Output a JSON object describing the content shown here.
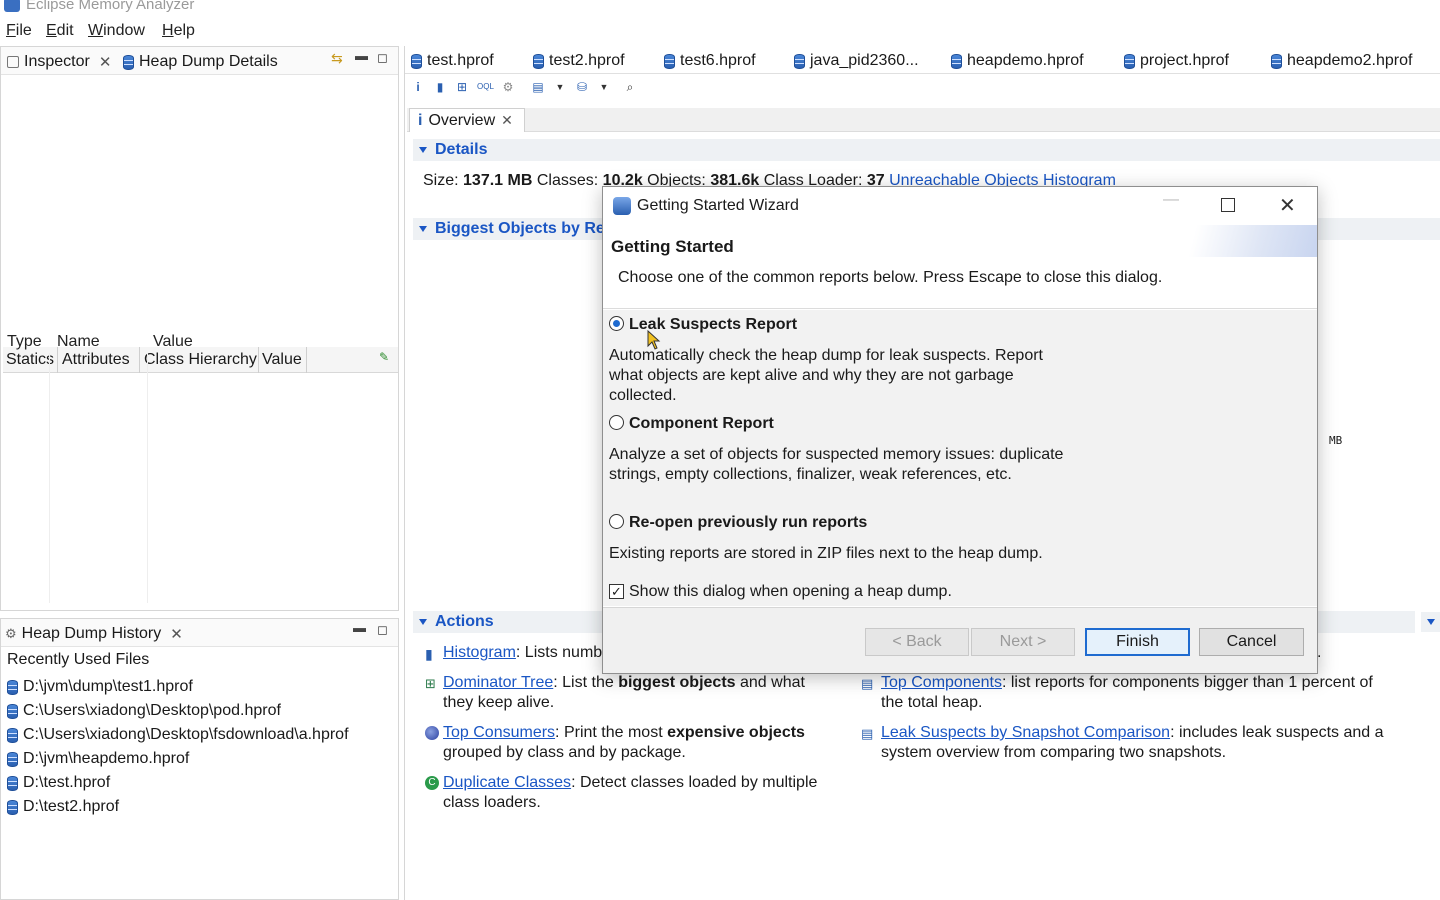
{
  "app": {
    "title": "Eclipse Memory Analyzer"
  },
  "menu": [
    "File",
    "Edit",
    "Window",
    "Help"
  ],
  "left_top": {
    "tabs": [
      "Inspector",
      "Heap Dump Details"
    ],
    "sub_tabs": [
      "Statics",
      "Attributes",
      "Class Hierarchy",
      "Value"
    ],
    "columns": [
      "Type",
      "Name",
      "Value"
    ]
  },
  "history": {
    "tab": "Heap Dump History",
    "header": "Recently Used Files",
    "files": [
      "D:\\jvm\\dump\\test1.hprof",
      "C:\\Users\\xiadong\\Desktop\\pod.hprof",
      "C:\\Users\\xiadong\\Desktop\\fsdownload\\a.hprof",
      "D:\\jvm\\heapdemo.hprof",
      "D:\\test.hprof",
      "D:\\test2.hprof"
    ]
  },
  "file_tabs": [
    "test.hprof",
    "test2.hprof",
    "test6.hprof",
    "java_pid2360...",
    "heapdemo.hprof",
    "project.hprof",
    "heapdemo2.hprof"
  ],
  "overview": {
    "tab": "Overview",
    "details_title": "Details",
    "size_label": "Size:",
    "size_value": "137.1 MB",
    "classes_label": "Classes:",
    "classes_value": "10.2k",
    "objects_label": "Objects:",
    "objects_value": "381.6k",
    "loader_label": "Class Loader:",
    "loader_value": "37",
    "unreachable_link": "Unreachable Objects Histogram",
    "biggest_title": "Biggest Objects by Reta",
    "mb_fragment": "MB",
    "actions_title": "Actions",
    "actions": {
      "histogram_link": "Histogram",
      "histogram_text": ": Lists numb",
      "dominator_link": "Dominator Tree",
      "dominator_text_a": ": List the ",
      "dominator_bold": "biggest objects",
      "dominator_text_b": " and what",
      "dominator_text_c": "they keep alive.",
      "consumers_link": "Top Consumers",
      "consumers_text_a": ": Print the most ",
      "consumers_bold": "expensive objects",
      "consumers_text_b": "grouped by class and by package.",
      "duplicate_link": "Duplicate Classes",
      "duplicate_text_a": ": Detect classes loaded by multiple",
      "duplicate_text_b": "class loaders.",
      "components_link": "Top Components",
      "components_text_a": ": list reports for components bigger than 1 percent of",
      "components_text_b": "the total heap.",
      "snapshot_link": "Leak Suspects by Snapshot Comparison",
      "snapshot_text_a": ": includes leak suspects and a",
      "snapshot_text_b": "system overview from comparing two snapshots.",
      "dot_fragment": "."
    }
  },
  "dialog": {
    "title": "Getting Started Wizard",
    "heading": "Getting Started",
    "subtitle": "Choose one of the common reports below. Press Escape to close this dialog.",
    "options": [
      {
        "title": "Leak Suspects Report",
        "selected": true,
        "desc": "Automatically check the heap dump for leak suspects. Report what objects are kept alive and why they are not garbage collected."
      },
      {
        "title": "Component Report",
        "selected": false,
        "desc": "Analyze a set of objects for suspected memory issues: duplicate strings, empty collections, finalizer, weak references, etc."
      },
      {
        "title": "Re-open previously run reports",
        "selected": false,
        "desc": "Existing reports are stored in ZIP files next to the heap dump."
      }
    ],
    "checkbox_label": "Show this dialog when opening a heap dump.",
    "checkbox_checked": true,
    "buttons": {
      "back": "< Back",
      "next": "Next >",
      "finish": "Finish",
      "cancel": "Cancel"
    }
  },
  "colors": {
    "link": "#1a56c4",
    "accent": "#1f6bd0"
  }
}
